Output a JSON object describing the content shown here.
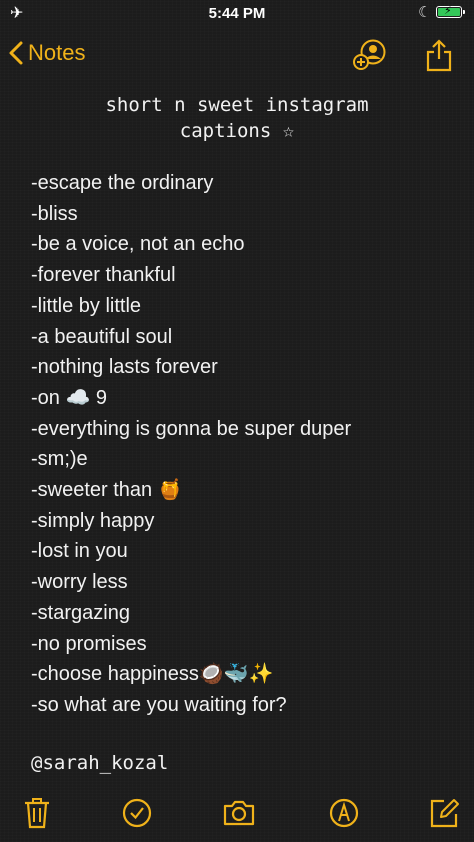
{
  "status_bar": {
    "time": "5:44 PM",
    "airplane_icon": "✈",
    "moon_icon": "☾"
  },
  "nav": {
    "back_label": "Notes",
    "accent_color": "#f0b21a"
  },
  "note": {
    "title_line1": "short n sweet instagram",
    "title_line2": "captions ☆",
    "captions": [
      "-escape the ordinary",
      "-bliss",
      "-be a voice, not an echo",
      "-forever thankful",
      "-little by little",
      "-a beautiful soul",
      "-nothing lasts forever",
      "-on ☁️ 9",
      "-everything is gonna be super duper",
      "-sm;)e",
      "-sweeter than 🍯",
      "-simply happy",
      "-lost in you",
      "-worry less",
      "-stargazing",
      "-no promises",
      "-choose happiness🥥🐳✨",
      "-so what are you waiting for?"
    ],
    "handle": "@sarah_kozal"
  },
  "toolbar": {
    "items": [
      "trash-icon",
      "checklist-icon",
      "camera-icon",
      "markup-icon",
      "compose-icon"
    ]
  }
}
